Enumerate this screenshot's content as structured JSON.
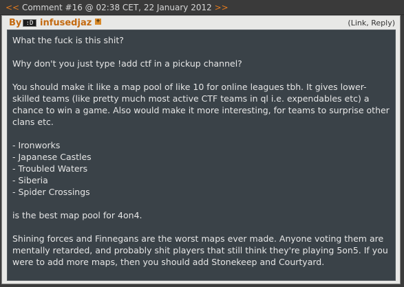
{
  "comment_link": {
    "prefix": "<<",
    "text": "Comment #16 @ 02:38 CET, 22 January 2012",
    "suffix": ">>"
  },
  "post": {
    "by_label": "By",
    "flag_text": ":D",
    "author": "infusedjaz",
    "plus_glyph": "+",
    "actions": {
      "open": "(",
      "link": "Link",
      "separator": ", ",
      "reply": "Reply",
      "close": ")"
    },
    "paragraphs": [
      "What the fuck is this shit?",
      "Why don't you just type !add ctf in a pickup channel?",
      "You should make it like a map pool of like 10 for online leagues tbh. It gives lower-skilled teams (like pretty much most active CTF teams in ql i.e. expendables etc) a chance to win a game. Also would make it more interesting, for teams to surprise other clans etc."
    ],
    "map_list": [
      "- Ironworks",
      "- Japanese Castles",
      "- Troubled Waters",
      "- Siberia",
      "- Spider Crossings"
    ],
    "closing_paragraphs": [
      "is the best map pool for 4on4.",
      "Shining forces and Finnegans are the worst maps ever made. Anyone voting them are mentally retarded, and probably shit players that still think they're playing 5on5. If you were to add more maps, then you should add Stonekeep and Courtyard."
    ]
  },
  "colors": {
    "accent": "#c46a10",
    "body_bg": "#3a4248",
    "panel_bg": "#e8e8e6",
    "text": "#e6e6e6"
  }
}
